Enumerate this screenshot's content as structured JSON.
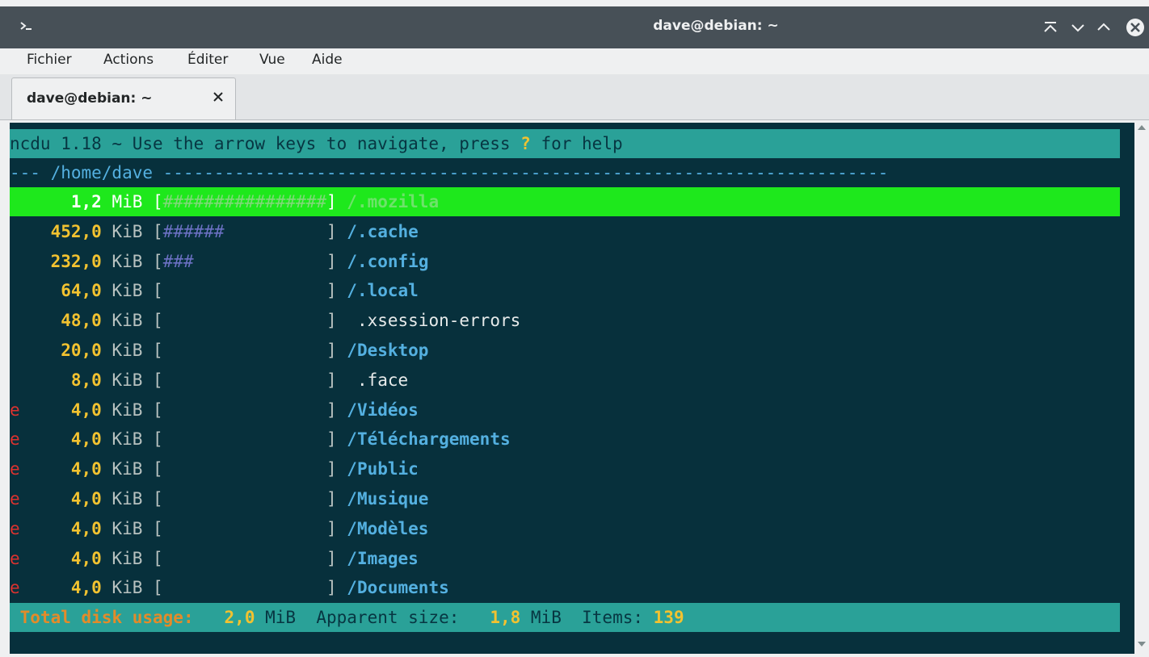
{
  "window": {
    "title": "dave@debian: ~"
  },
  "menu": [
    "Fichier",
    "Actions",
    "Éditer",
    "Vue",
    "Aide"
  ],
  "tab": {
    "label": "dave@debian: ~"
  },
  "terminal": {
    "header": {
      "pre": "ncdu 1.18 ~ Use the arrow keys to navigate, press ",
      "key": "?",
      "post": " for help"
    },
    "path_line": "--- /home/dave -----------------------------------------------------------------------",
    "rows": [
      {
        "flag": " ",
        "size": "1,2",
        "unit": "MiB",
        "bar": "################",
        "slash": "/",
        "name": ".mozilla",
        "selected": true
      },
      {
        "flag": " ",
        "size": "452,0",
        "unit": "KiB",
        "bar": "######",
        "slash": "/",
        "name": ".cache",
        "selected": false
      },
      {
        "flag": " ",
        "size": "232,0",
        "unit": "KiB",
        "bar": "###",
        "slash": "/",
        "name": ".config",
        "selected": false
      },
      {
        "flag": " ",
        "size": "64,0",
        "unit": "KiB",
        "bar": "",
        "slash": "/",
        "name": ".local",
        "selected": false
      },
      {
        "flag": " ",
        "size": "48,0",
        "unit": "KiB",
        "bar": "",
        "slash": " ",
        "name": ".xsession-errors",
        "selected": false
      },
      {
        "flag": " ",
        "size": "20,0",
        "unit": "KiB",
        "bar": "",
        "slash": "/",
        "name": "Desktop",
        "selected": false
      },
      {
        "flag": " ",
        "size": "8,0",
        "unit": "KiB",
        "bar": "",
        "slash": " ",
        "name": ".face",
        "selected": false
      },
      {
        "flag": "e",
        "size": "4,0",
        "unit": "KiB",
        "bar": "",
        "slash": "/",
        "name": "Vidéos",
        "selected": false
      },
      {
        "flag": "e",
        "size": "4,0",
        "unit": "KiB",
        "bar": "",
        "slash": "/",
        "name": "Téléchargements",
        "selected": false
      },
      {
        "flag": "e",
        "size": "4,0",
        "unit": "KiB",
        "bar": "",
        "slash": "/",
        "name": "Public",
        "selected": false
      },
      {
        "flag": "e",
        "size": "4,0",
        "unit": "KiB",
        "bar": "",
        "slash": "/",
        "name": "Musique",
        "selected": false
      },
      {
        "flag": "e",
        "size": "4,0",
        "unit": "KiB",
        "bar": "",
        "slash": "/",
        "name": "Modèles",
        "selected": false
      },
      {
        "flag": "e",
        "size": "4,0",
        "unit": "KiB",
        "bar": "",
        "slash": "/",
        "name": "Images",
        "selected": false
      },
      {
        "flag": "e",
        "size": "4,0",
        "unit": "KiB",
        "bar": "",
        "slash": "/",
        "name": "Documents",
        "selected": false
      }
    ],
    "footer": {
      "total_label": "Total disk usage:",
      "total_value": "2,0",
      "total_unit": "MiB",
      "apparent_label": "Apparent size:",
      "apparent_value": "1,8",
      "apparent_unit": "MiB",
      "items_label": "Items:",
      "items_value": "139"
    }
  },
  "colors": {
    "terminal_bg": "#07303c",
    "header_bg": "#2aa198",
    "selection_bg": "#1ee81c",
    "size_number": "#f2c230",
    "directory": "#54b0e0",
    "bar_hash": "#6c71c4",
    "error_flag": "#dc322f"
  },
  "icons": [
    "terminal-icon",
    "keep-above-icon",
    "minimize-icon",
    "maximize-icon",
    "close-icon",
    "tab-close-icon",
    "scroll-up-icon",
    "scroll-down-icon"
  ]
}
